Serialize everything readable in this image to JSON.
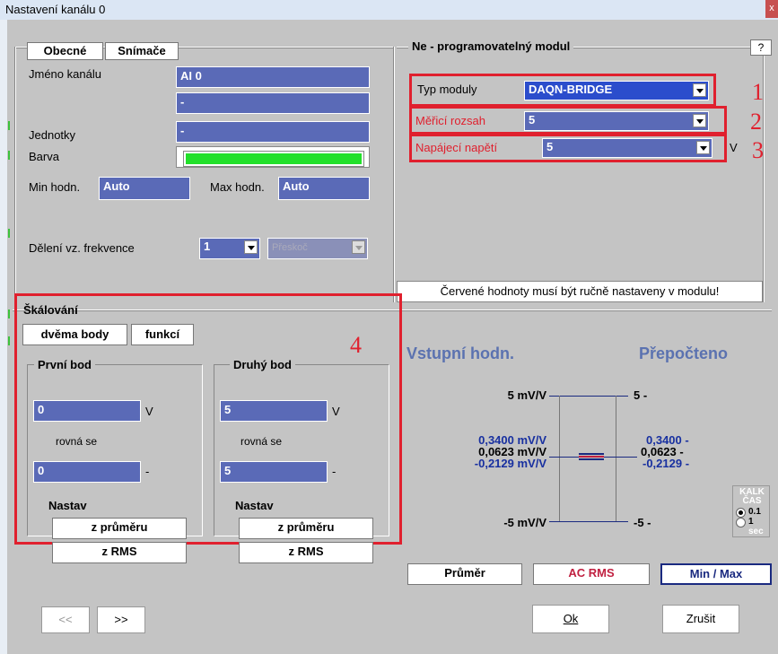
{
  "window": {
    "title": "Nastavení kanálu 0",
    "close": "x"
  },
  "tabs": {
    "general": "Obecné",
    "sensors": "Snímače"
  },
  "general": {
    "channel_name_label": "Jméno kanálu",
    "channel_name": "AI 0",
    "channel_name2": "-",
    "units_label": "Jednotky",
    "units": "-",
    "color_label": "Barva",
    "color": "#22e02a",
    "min_label": "Min hodn.",
    "min": "Auto",
    "max_label": "Max hodn.",
    "max": "Auto",
    "freq_label": "Dělení vz. frekvence",
    "freq": "1",
    "freq_placeholder": "Přeskoč"
  },
  "module": {
    "title": "Ne - programovatelný modul",
    "help": "?",
    "type_label": "Typ moduly",
    "type": "DAQN-BRIDGE",
    "range_label": "Měřicí rozsah",
    "range": "5",
    "voltage_label": "Napájecí napětí",
    "voltage": "5",
    "voltage_unit": "V",
    "note": "Červené hodnoty musí být ručně nastaveny v modulu!"
  },
  "annotations": {
    "n1": "1",
    "n2": "2",
    "n3": "3",
    "n4": "4"
  },
  "scaling": {
    "title": "Škálování",
    "tab_two_points": "dvěma body",
    "tab_function": "funkcí",
    "first": {
      "title": "První bod",
      "input": "0",
      "input_unit": "V",
      "equals": "rovná se",
      "output": "0",
      "output_unit": "-",
      "set_label": "Nastav",
      "btn_avg": "z průměru",
      "btn_rms": "z RMS"
    },
    "second": {
      "title": "Druhý bod",
      "input": "5",
      "input_unit": "V",
      "equals": "rovná se",
      "output": "5",
      "output_unit": "-",
      "set_label": "Nastav",
      "btn_avg": "z průměru",
      "btn_rms": "z RMS"
    }
  },
  "preview": {
    "input_head": "Vstupní hodn.",
    "output_head": "Přepočteno",
    "in_top": "5 mV/V",
    "out_top": "5 -",
    "in_v1": "0,3400 mV/V",
    "in_v2": "0,0623 mV/V",
    "in_v3": "-0,2129 mV/V",
    "out_v1": "0,3400 -",
    "out_v2": "0,0623 -",
    "out_v3": "-0,2129 -",
    "in_bot": "-5 mV/V",
    "out_bot": "-5 -",
    "kalk_label": "KALK ČAS",
    "opt1": "0.1",
    "opt2": "1",
    "sec": "sec",
    "mode_avg": "Průměr",
    "mode_rms": "AC RMS",
    "mode_minmax": "Min / Max"
  },
  "footer": {
    "prev": "<<",
    "next": ">>",
    "ok": "Ok",
    "cancel": "Zrušit"
  }
}
